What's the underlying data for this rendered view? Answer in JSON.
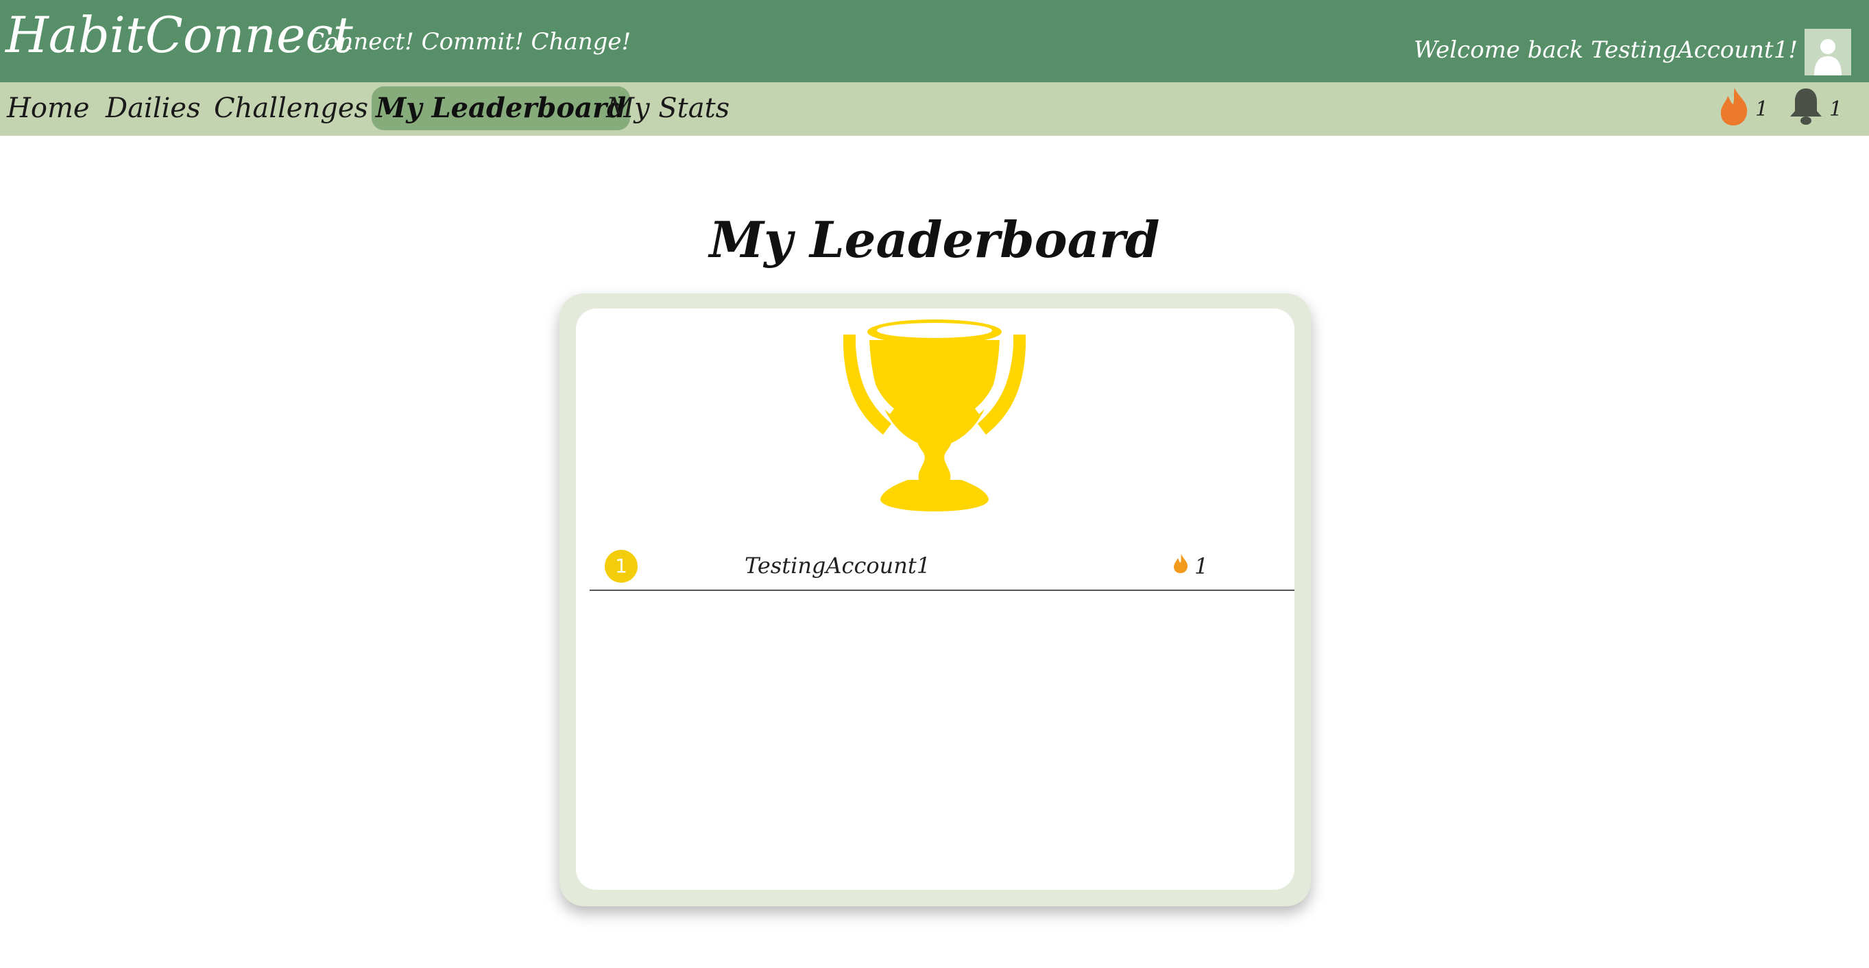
{
  "header": {
    "brand": "HabitConnect",
    "tagline": "Connect! Commit! Change!",
    "welcome": "Welcome back TestingAccount1!",
    "avatar_icon": "user-avatar-icon",
    "background_color": "#568f68"
  },
  "nav": {
    "items": [
      {
        "label": "Home",
        "active": false
      },
      {
        "label": "Dailies",
        "active": false
      },
      {
        "label": "Challenges",
        "active": false
      },
      {
        "label": "My Leaderboard",
        "active": true
      },
      {
        "label": "My Stats",
        "active": false
      }
    ],
    "streak_icon": "flame-icon",
    "streak_count": "1",
    "notification_icon": "bell-icon",
    "notification_count": "1",
    "background_color": "#c4d4b1",
    "active_color": "#87ac7c"
  },
  "main": {
    "title": "My Leaderboard",
    "trophy_icon": "trophy-icon",
    "trophy_color": "#ffd500",
    "leaderboard": [
      {
        "rank": "1",
        "name": "TestingAccount1",
        "score_icon": "flame-icon",
        "score": "1"
      }
    ]
  }
}
